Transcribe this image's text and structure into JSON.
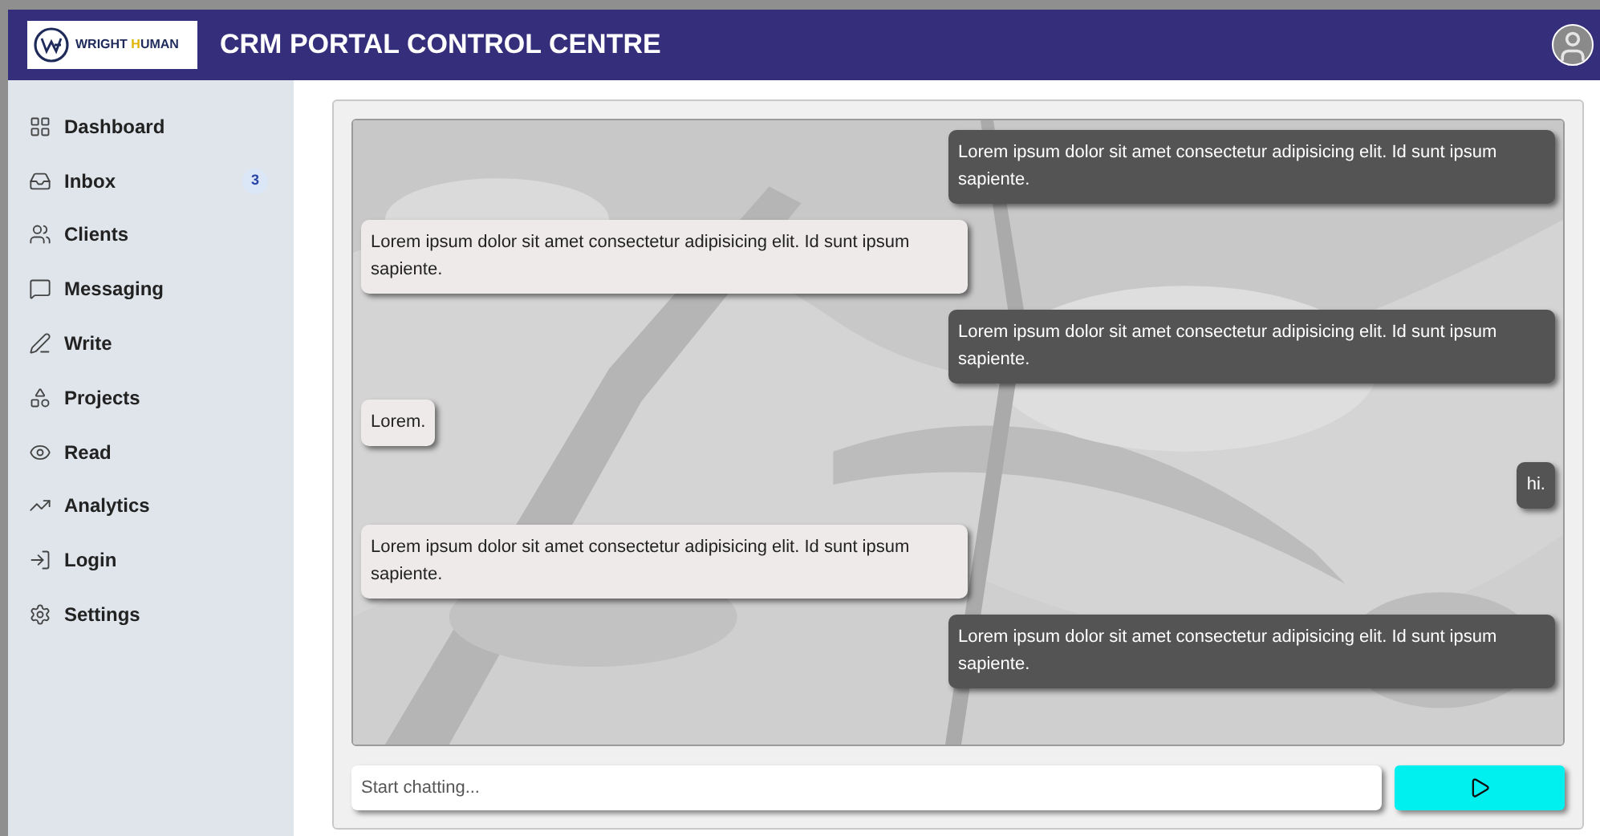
{
  "header": {
    "logo_text": "WRIGHT ",
    "logo_highlight": "H",
    "logo_rest": "UMAN",
    "title": "CRM PORTAL CONTROL CENTRE"
  },
  "sidebar": {
    "items": [
      {
        "label": "Dashboard"
      },
      {
        "label": "Inbox",
        "badge": "3"
      },
      {
        "label": "Clients"
      },
      {
        "label": "Messaging"
      },
      {
        "label": "Write"
      },
      {
        "label": "Projects"
      },
      {
        "label": "Read"
      },
      {
        "label": "Analytics"
      },
      {
        "label": "Login"
      },
      {
        "label": "Settings"
      }
    ]
  },
  "chat": {
    "messages": [
      {
        "kind": "sent",
        "text": "Lorem ipsum dolor sit amet consectetur adipisicing elit. Id sunt ipsum sapiente."
      },
      {
        "kind": "received",
        "text": "Lorem ipsum dolor sit amet consectetur adipisicing elit. Id sunt ipsum sapiente."
      },
      {
        "kind": "sent",
        "text": "Lorem ipsum dolor sit amet consectetur adipisicing elit. Id sunt ipsum sapiente."
      },
      {
        "kind": "received",
        "text": "Lorem."
      },
      {
        "kind": "sent",
        "text": "hi."
      },
      {
        "kind": "received",
        "text": "Lorem ipsum dolor sit amet consectetur adipisicing elit. Id sunt ipsum sapiente."
      },
      {
        "kind": "sent",
        "text": "Lorem ipsum dolor sit amet consectetur adipisicing elit. Id sunt ipsum sapiente."
      }
    ],
    "input": {
      "placeholder": "Start chatting..."
    }
  }
}
